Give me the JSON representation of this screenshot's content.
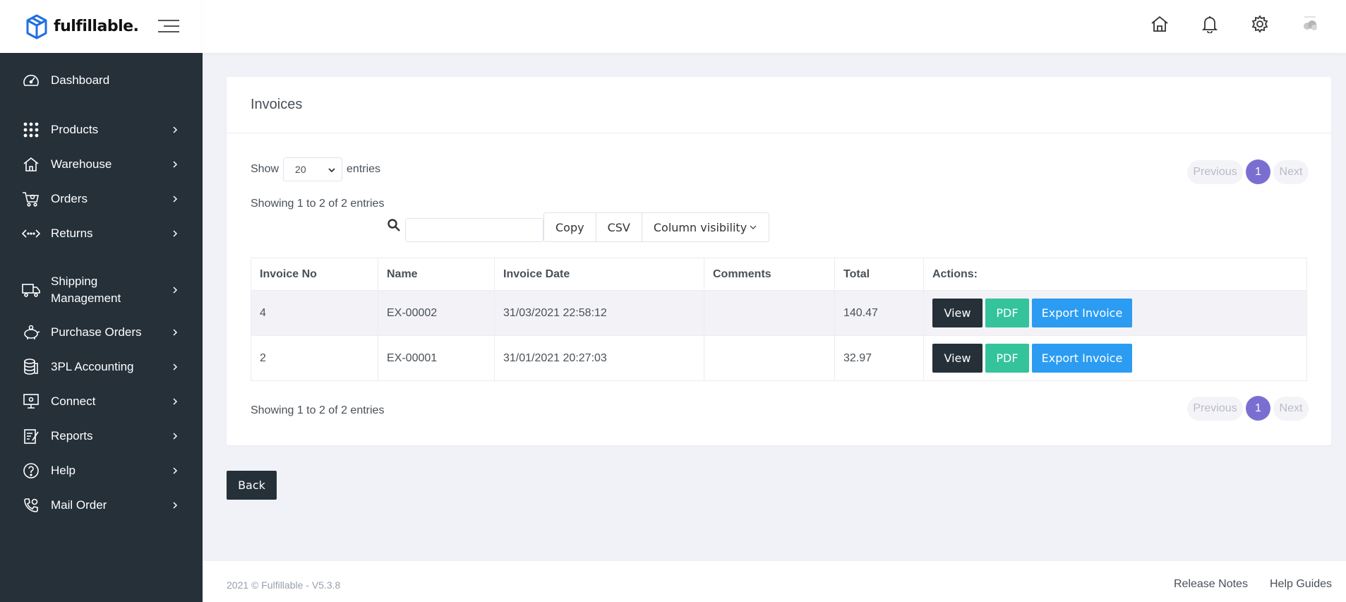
{
  "brand": {
    "name": "fulfillable."
  },
  "sidebar": {
    "items": [
      {
        "label": "Dashboard",
        "icon": "dashboard-icon"
      },
      {
        "label": "Products",
        "icon": "grid-icon"
      },
      {
        "label": "Warehouse",
        "icon": "warehouse-icon"
      },
      {
        "label": "Orders",
        "icon": "cart-icon"
      },
      {
        "label": "Returns",
        "icon": "returns-icon"
      },
      {
        "label": "Shipping\nManagement",
        "icon": "truck-icon"
      },
      {
        "label": "Purchase Orders",
        "icon": "piggy-bank-icon"
      },
      {
        "label": "3PL Accounting",
        "icon": "coins-icon"
      },
      {
        "label": "Connect",
        "icon": "monitor-icon"
      },
      {
        "label": "Reports",
        "icon": "report-icon"
      },
      {
        "label": "Help",
        "icon": "help-icon"
      },
      {
        "label": "Mail Order",
        "icon": "phone-icon"
      }
    ]
  },
  "header": {
    "icons": [
      "home-icon",
      "bell-icon",
      "gear-icon",
      "avatar"
    ]
  },
  "invoices": {
    "title": "Invoices",
    "show_label": "Show",
    "entries_label": "entries",
    "page_size": "20",
    "info": "Showing 1 to 2 of 2 entries",
    "search_placeholder": "",
    "buttons": {
      "copy": "Copy",
      "csv": "CSV",
      "column_visibility": "Column visibility"
    },
    "pagination": {
      "previous": "Previous",
      "current": "1",
      "next": "Next"
    },
    "columns": [
      "Invoice No",
      "Name",
      "Invoice Date",
      "Comments",
      "Total",
      "Actions:"
    ],
    "rows": [
      {
        "invoice_no": "4",
        "name": "EX-00002",
        "date": "31/03/2021 22:58:12",
        "comments": "",
        "total": "140.47"
      },
      {
        "invoice_no": "2",
        "name": "EX-00001",
        "date": "31/01/2021 20:27:03",
        "comments": "",
        "total": "32.97"
      }
    ],
    "actions": {
      "view": "View",
      "pdf": "PDF",
      "export": "Export Invoice"
    }
  },
  "back_label": "Back",
  "footer": {
    "copyright": "2021 © Fulfillable - V5.3.8",
    "release_notes": "Release Notes",
    "help_guides": "Help Guides"
  },
  "colors": {
    "sidebar_bg": "#253039",
    "accent_purple": "#7a6fd1",
    "pdf_green": "#35c39b",
    "export_blue": "#2b9cf2",
    "logo_blue": "#1f6fe5"
  }
}
